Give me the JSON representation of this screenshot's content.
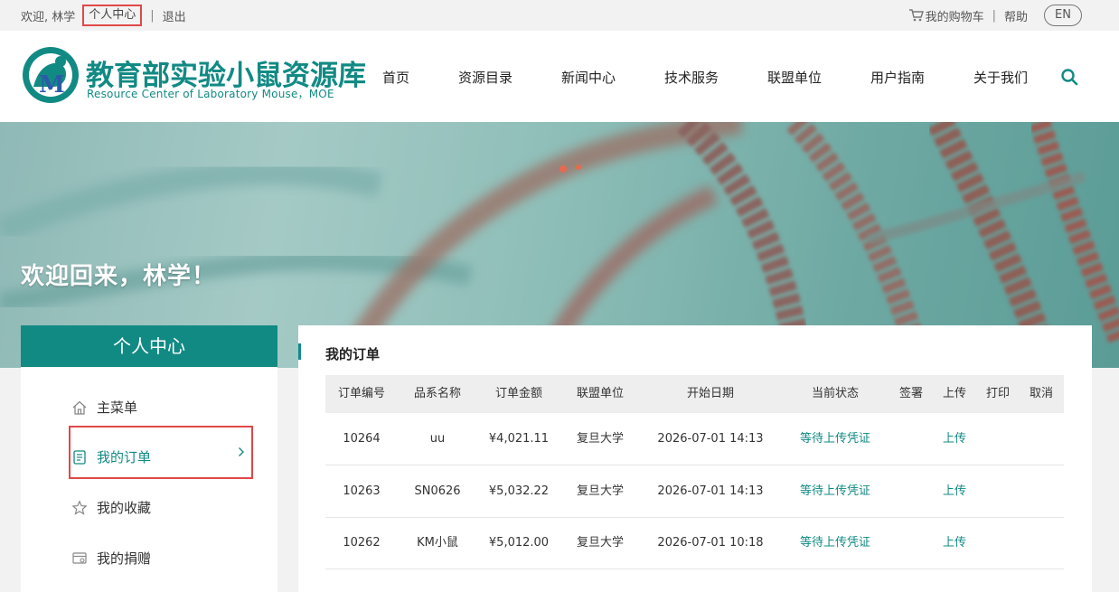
{
  "topbar": {
    "welcome": "欢迎, 林学",
    "personal_center": "个人中心",
    "logout": "退出",
    "cart": "我的购物车",
    "help": "帮助",
    "lang": "EN"
  },
  "header": {
    "logo_cn": "教育部实验小鼠资源库",
    "logo_en": "Resource Center of Laboratory Mouse，MOE",
    "nav": [
      "首页",
      "资源目录",
      "新闻中心",
      "技术服务",
      "联盟单位",
      "用户指南",
      "关于我们"
    ]
  },
  "banner": {
    "welcome": "欢迎回来，林学！"
  },
  "sidebar": {
    "title": "个人中心",
    "items": [
      {
        "label": "主菜单",
        "icon": "home-icon"
      },
      {
        "label": "我的订单",
        "icon": "order-icon"
      },
      {
        "label": "我的收藏",
        "icon": "star-icon"
      },
      {
        "label": "我的捐赠",
        "icon": "donate-icon"
      }
    ]
  },
  "orders": {
    "title": "我的订单",
    "columns": [
      "订单编号",
      "品系名称",
      "订单金额",
      "联盟单位",
      "开始日期",
      "当前状态",
      "签署",
      "上传",
      "打印",
      "取消"
    ],
    "rows": [
      {
        "id": "10264",
        "strain": "uu",
        "amount": "¥4,021.11",
        "unit": "复旦大学",
        "date": "2026-07-01 14:13",
        "status": "等待上传凭证",
        "sign": "",
        "upload": "上传",
        "print": "",
        "cancel": ""
      },
      {
        "id": "10263",
        "strain": "SN0626",
        "amount": "¥5,032.22",
        "unit": "复旦大学",
        "date": "2026-07-01 14:13",
        "status": "等待上传凭证",
        "sign": "",
        "upload": "上传",
        "print": "",
        "cancel": ""
      },
      {
        "id": "10262",
        "strain": "KM小鼠",
        "amount": "¥5,012.00",
        "unit": "复旦大学",
        "date": "2026-07-01 10:18",
        "status": "等待上传凭证",
        "sign": "",
        "upload": "上传",
        "print": "",
        "cancel": ""
      }
    ]
  },
  "colors": {
    "brand": "#128a84",
    "highlight": "#e04848"
  }
}
